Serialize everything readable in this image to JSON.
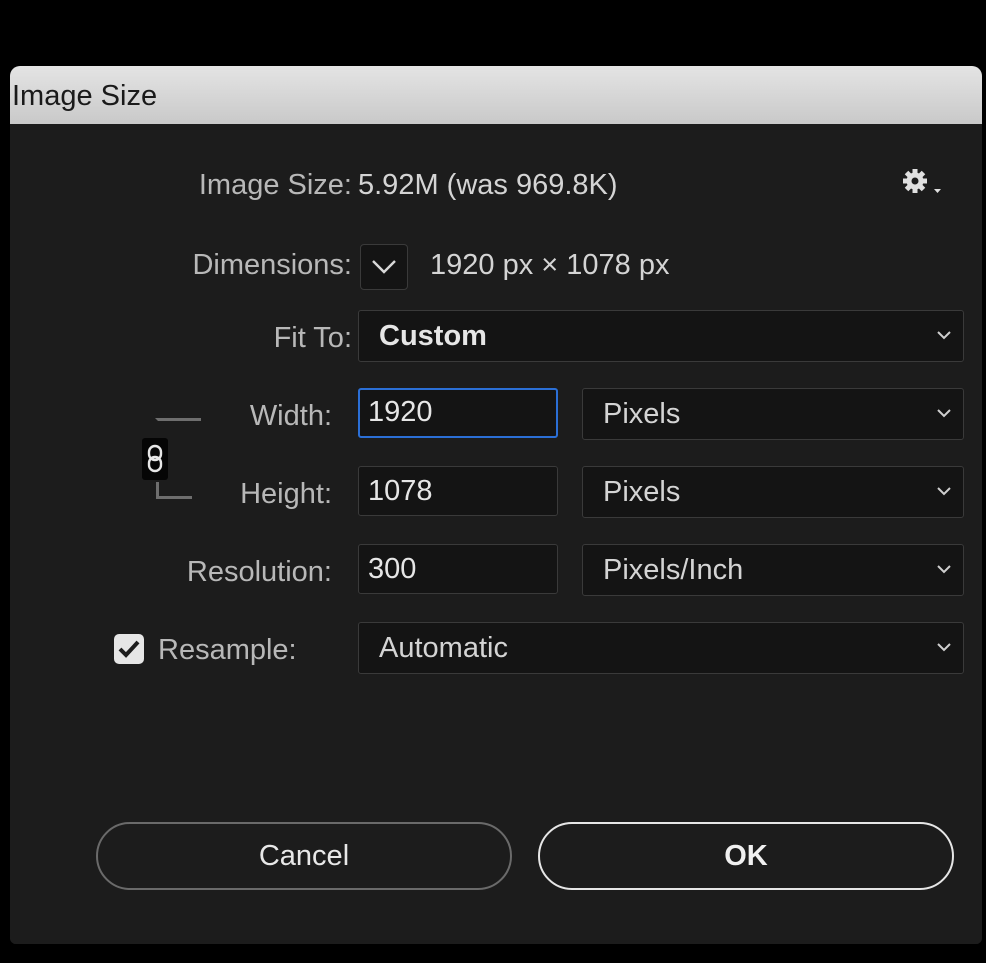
{
  "window": {
    "title": "Image Size"
  },
  "image_size": {
    "label": "Image Size:",
    "value": "5.92M (was 969.8K)"
  },
  "settings_icon": "gear-icon",
  "dimensions": {
    "label": "Dimensions:",
    "value": "1920 px  ×  1078 px"
  },
  "fit_to": {
    "label": "Fit To:",
    "selected": "Custom"
  },
  "width": {
    "label": "Width:",
    "value": "1920",
    "unit": "Pixels"
  },
  "height": {
    "label": "Height:",
    "value": "1078",
    "unit": "Pixels"
  },
  "resolution": {
    "label": "Resolution:",
    "value": "300",
    "unit": "Pixels/Inch"
  },
  "resample": {
    "label": "Resample:",
    "checked": true,
    "selected": "Automatic"
  },
  "buttons": {
    "cancel": "Cancel",
    "ok": "OK"
  },
  "colors": {
    "accent": "#2b6fd6",
    "background": "#1c1c1c",
    "titlebar": "#d6d6d6"
  }
}
